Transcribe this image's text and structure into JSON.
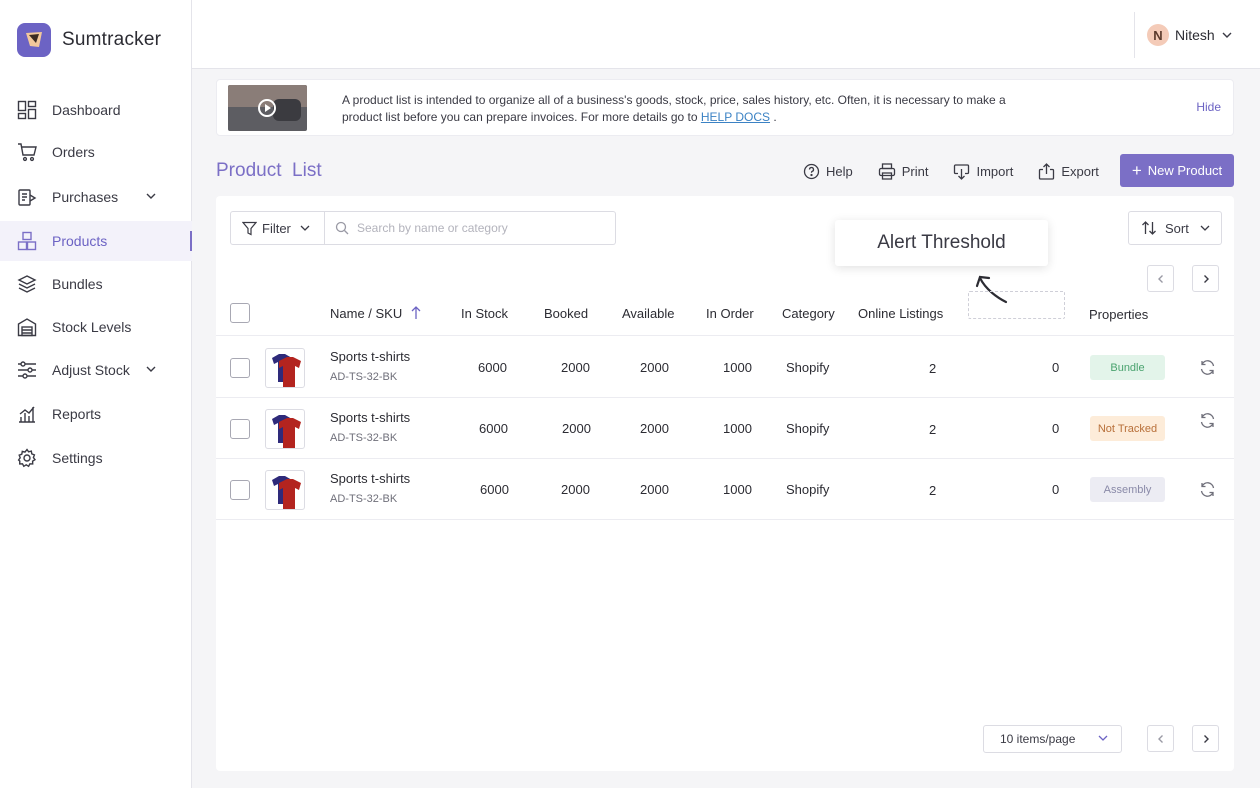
{
  "app": {
    "name": "Sumtracker",
    "accent": "#7b6fc6"
  },
  "sidebar": {
    "items": [
      {
        "label": "Dashboard",
        "icon": "dashboard-icon"
      },
      {
        "label": "Orders",
        "icon": "cart-icon"
      },
      {
        "label": "Purchases",
        "icon": "purchases-icon",
        "expandable": true
      },
      {
        "label": "Products",
        "icon": "products-icon",
        "active": true
      },
      {
        "label": "Bundles",
        "icon": "layers-icon"
      },
      {
        "label": "Stock Levels",
        "icon": "warehouse-icon"
      },
      {
        "label": "Adjust Stock",
        "icon": "sliders-icon",
        "expandable": true
      },
      {
        "label": "Reports",
        "icon": "bar-chart-icon"
      },
      {
        "label": "Settings",
        "icon": "gear-icon"
      }
    ]
  },
  "user": {
    "initial": "N",
    "name": "Nitesh"
  },
  "banner": {
    "text": "A product list is intended to organize all of a business's goods, stock, price, sales history, etc. Often, it is necessary to make a product list before you can prepare invoices. For more details go to",
    "link": "HELP DOCS",
    "suffix": ".",
    "hide": "Hide"
  },
  "page": {
    "title": "Product  List",
    "actions": {
      "help": "Help",
      "print": "Print",
      "import": "Import",
      "export": "Export"
    },
    "new_button": "New Product"
  },
  "toolbar": {
    "filter": "Filter",
    "search_placeholder": "Search by name or category",
    "sort": "Sort"
  },
  "tooltip": "Alert Threshold",
  "table": {
    "columns": [
      "Name / SKU",
      "In Stock",
      "Booked",
      "Available",
      "In Order",
      "Category",
      "Online Listings",
      "Properties"
    ],
    "rows": [
      {
        "name": "Sports t-shirts",
        "sku": "AD-TS-32-BK",
        "in_stock": "6000",
        "booked": "2000",
        "available": "2000",
        "in_order": "1000",
        "category": "Shopify",
        "online_listings": "2",
        "threshold": "0",
        "property": "Bundle"
      },
      {
        "name": "Sports t-shirts",
        "sku": "AD-TS-32-BK",
        "in_stock": "6000",
        "booked": "2000",
        "available": "2000",
        "in_order": "1000",
        "category": "Shopify",
        "online_listings": "2",
        "threshold": "0",
        "property": "Not Tracked"
      },
      {
        "name": "Sports t-shirts",
        "sku": "AD-TS-32-BK",
        "in_stock": "6000",
        "booked": "2000",
        "available": "2000",
        "in_order": "1000",
        "category": "Shopify",
        "online_listings": "2",
        "threshold": "0",
        "property": "Assembly"
      }
    ],
    "badge_colors": {
      "Bundle": {
        "bg": "#e3f4ea",
        "fg": "#4aa36f"
      },
      "Not Tracked": {
        "bg": "#fdecd9",
        "fg": "#b8703a"
      },
      "Assembly": {
        "bg": "#ececf3",
        "fg": "#8a8aa8"
      }
    }
  },
  "pagination": {
    "per_page": "10 items/page"
  }
}
